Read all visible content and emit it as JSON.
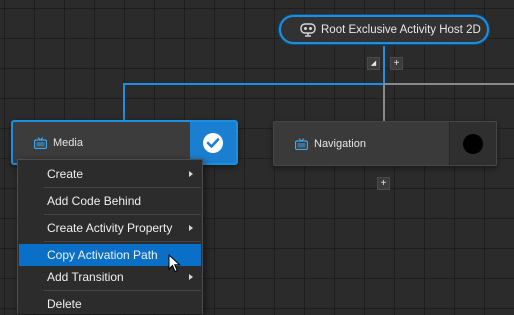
{
  "root_node": {
    "label": "Root Exclusive Activity Host 2D",
    "icon": "activity-host-icon"
  },
  "root_controls": {
    "collapse_glyph": "◢",
    "add_glyph": "+"
  },
  "nodes": [
    {
      "label": "Media",
      "icon": "tv-icon",
      "state": "active",
      "badge_icon": "checkmark-icon"
    },
    {
      "label": "Navigation",
      "icon": "tv-icon",
      "state": "inactive",
      "badge_icon": "black-dot-icon"
    }
  ],
  "navigation_add_glyph": "+",
  "context_menu": {
    "items": [
      {
        "label": "Create",
        "has_submenu": true
      },
      {
        "label": "Add Code Behind",
        "has_submenu": false
      },
      {
        "label": "Create Activity Property",
        "has_submenu": true
      },
      {
        "label": "Copy Activation Path",
        "has_submenu": false,
        "highlighted": true
      },
      {
        "label": "Add Transition",
        "has_submenu": true
      },
      {
        "label": "Delete",
        "has_submenu": false
      }
    ]
  },
  "colors": {
    "accent": "#1c8fe0",
    "highlight": "#0a6fc6",
    "background": "#2b2b2b",
    "node_bg": "#3a3a3a"
  }
}
